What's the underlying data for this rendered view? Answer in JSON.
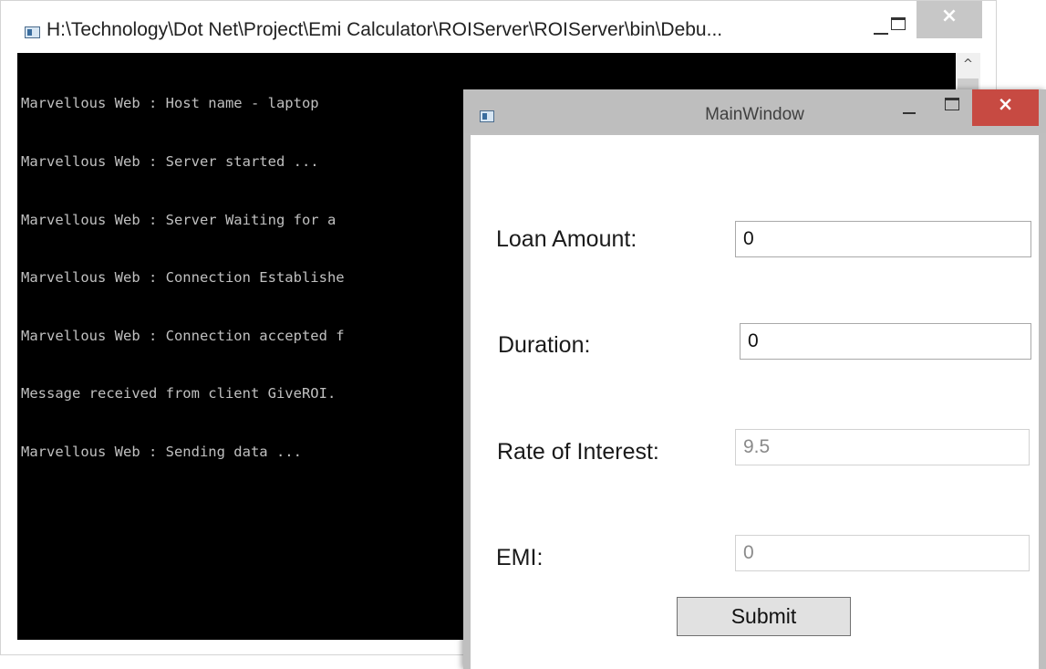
{
  "console_window": {
    "title": "H:\\Technology\\Dot Net\\Project\\Emi Calculator\\ROIServer\\ROIServer\\bin\\Debu...",
    "close_glyph": "×",
    "scroll_up_glyph": "^",
    "lines": [
      "Marvellous Web : Host name - laptop",
      "Marvellous Web : Server started ...",
      "Marvellous Web : Server Waiting for a",
      "Marvellous Web : Connection Establishe",
      "Marvellous Web : Connection accepted f",
      "Message received from client GiveROI.",
      "Marvellous Web : Sending data ..."
    ],
    "colors": {
      "background": "#000000",
      "text": "#c0c0c0"
    }
  },
  "main_window": {
    "title": "MainWindow",
    "close_glyph": "×",
    "fields": {
      "loan_amount": {
        "label": "Loan Amount:",
        "value": "0"
      },
      "duration": {
        "label": "Duration:",
        "value": "0"
      },
      "rate_of_interest": {
        "label": "Rate of Interest:",
        "value": "9.5"
      },
      "emi": {
        "label": "EMI:",
        "value": "0"
      }
    },
    "submit_label": "Submit",
    "colors": {
      "close_button": "#c74a42",
      "titlebar": "#bebebe"
    }
  }
}
